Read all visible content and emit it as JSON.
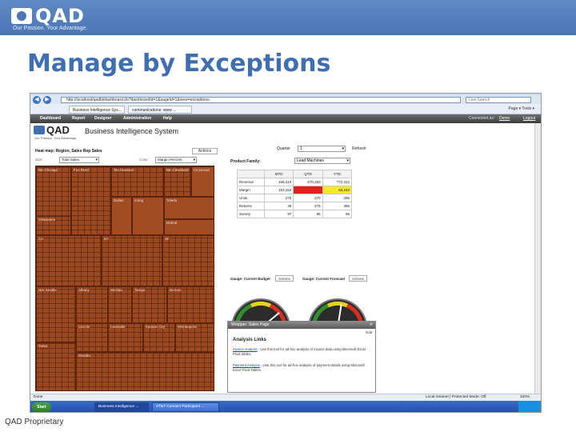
{
  "slide": {
    "brand": "QAD",
    "tagline": "Our Passion. Your Advantage.",
    "title": "Manage by Exceptions",
    "footer": "QAD Proprietary"
  },
  "browser": {
    "address": "http://localhost/qadbi/dashboard.do?dashboardId=1&pageId=1&view=exceptions",
    "search_placeholder": "Live Search",
    "tabs": [
      {
        "label": "Business Intelligence Sys..."
      },
      {
        "label": "communications: www ..."
      }
    ],
    "tools": "Page ▾  Tools ▾"
  },
  "menu": {
    "items": [
      "Dashboard",
      "Report",
      "Designer",
      "Administration",
      "Help"
    ],
    "connected_as": "Connected as:",
    "user": "Demo",
    "logout": "Logout"
  },
  "app": {
    "brand": "QAD",
    "tagline": "Our Passion. Your Advantage.",
    "title": "Business Intelligence System",
    "treemap": {
      "header": "Heat map: Region, Sales Rep Sales",
      "actions": "Actions",
      "size_label": "Size:",
      "size_value": "Total Sales",
      "color_label": "Color:",
      "color_value": "Margin Percent",
      "cells": [
        {
          "label": "NE Chicago"
        },
        {
          "label": "Fox River"
        },
        {
          "label": "Tex Houston"
        },
        {
          "label": "NE Cleveland"
        },
        {
          "label": "Cincinnati"
        },
        {
          "label": "Milwaukee"
        },
        {
          "label": "Dallas"
        },
        {
          "label": "Irving"
        },
        {
          "label": "Toledo"
        },
        {
          "label": "Detroit"
        },
        {
          "label": "CA"
        },
        {
          "label": "NY"
        },
        {
          "label": "SF"
        },
        {
          "label": "NW Seattle"
        },
        {
          "label": "Albany"
        },
        {
          "label": "Wichita"
        },
        {
          "label": "Tampa"
        },
        {
          "label": "Denver"
        },
        {
          "label": "Lincoln"
        },
        {
          "label": "Louisville"
        },
        {
          "label": "Kansas City"
        },
        {
          "label": "Minneapolis"
        },
        {
          "label": "Tulsa"
        },
        {
          "label": "Omaha"
        }
      ]
    },
    "filter": {
      "quarter_label": "Quarter",
      "quarter_value": "1",
      "refresh": "Refresh",
      "family_label": "Product Family:",
      "family_value": "Lead Machines"
    },
    "grid": {
      "headers": [
        "",
        "MTD",
        "QTD",
        "YTD"
      ],
      "rows": [
        {
          "name": "Revenue",
          "mtd": "469,210",
          "qtd": "670,283",
          "ytd": "772,312"
        },
        {
          "name": "Margin",
          "mtd": "153,154",
          "qtd": "",
          "ytd": "53,154"
        },
        {
          "name": "Units",
          "mtd": "276",
          "qtd": "279",
          "ytd": "296"
        },
        {
          "name": "Returns",
          "mtd": "48",
          "qtd": "275",
          "ytd": "486"
        },
        {
          "name": "Survey",
          "mtd": "97",
          "qtd": "96",
          "ytd": "95"
        }
      ]
    },
    "gauges": [
      {
        "header": "Gauge: Current Budget",
        "action": "Actions",
        "value": 0.78
      },
      {
        "header": "Gauge: Current Forecast",
        "action": "Actions",
        "value": 0.55
      }
    ],
    "popup": {
      "title": "Wrapper: Sales Page",
      "edit": "Edit",
      "heading": "Analysis Links",
      "link1": "Invoice Analysis",
      "text1": "- Use this tool for ad-hoc analysis of invoice data using Microsoft Excel Pivot tables.",
      "link2": "Payment Analysis",
      "text2": "- Use this tool for ad-hoc analysis of payment details using Microsoft Excel Pivot Tables."
    }
  },
  "status": {
    "left": "Done",
    "zone": "Local intranet | Protected Mode: Off",
    "zoom": "100%"
  },
  "taskbar": {
    "start": "Start",
    "buttons": [
      {
        "label": "Business Intelligence ..."
      },
      {
        "label": "AT&T Connect Participant ..."
      }
    ]
  },
  "colors": {
    "brand_blue": "#4a76b6",
    "treemap_base": "#9b4720",
    "exception_red": "#e3211a",
    "warning_yellow": "#f6e926"
  }
}
